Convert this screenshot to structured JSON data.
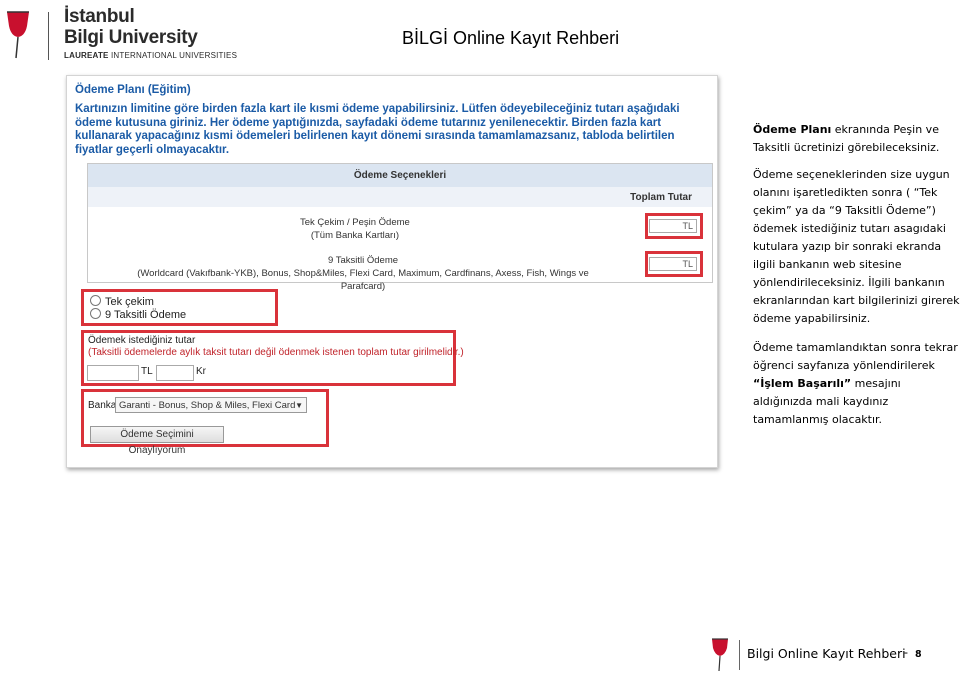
{
  "header": {
    "logo_line1": "İstanbul",
    "logo_line2": "Bilgi University",
    "logo_line3_bold": "LAUREATE",
    "logo_line3_rest": "INTERNATIONAL UNIVERSITIES",
    "doc_title": "BİLGİ Online Kayıt Rehberi"
  },
  "screenshot": {
    "plan_title": "Ödeme Planı (Eğitim)",
    "info_text": "Kartınızın limitine göre birden fazla kart ile kısmi ödeme yapabilirsiniz. Lütfen ödeyebileceğiniz tutarı aşağıdaki ödeme kutusuna giriniz. Her ödeme yaptığınızda, sayfadaki ödeme tutarınız yenilenecektir. Birden fazla kart kullanarak yapacağınız kısmi ödemeleri belirlenen kayıt dönemi sırasında tamamlamazsanız, tabloda belirtilen fiyatlar geçerli olmayacaktır.",
    "options_header": "Ödeme Seçenekleri",
    "total_header": "Toplam Tutar",
    "option1_line1": "Tek Çekim / Peşin Ödeme",
    "option1_line2": "(Tüm Banka Kartları)",
    "option2_line1": "9 Taksitli Ödeme",
    "option2_line2": "(Worldcard (Vakıfbank-YKB), Bonus, Shop&Miles, Flexi Card, Maximum, Cardfinans, Axess, Fish, Wings ve Parafcard)",
    "currency": "TL",
    "radio_options": [
      "Tek çekim",
      "9 Taksitli Ödeme"
    ],
    "amount_label": "Ödemek istediğiniz tutar",
    "amount_warning": "(Taksitli ödemelerde aylık taksit tutarı değil ödenmek istenen toplam tutar girilmelidir.)",
    "amount_tl": "TL",
    "amount_kr": "Kr",
    "bank_label": "Banka",
    "bank_selected": "Garanti - Bonus, Shop & Miles, Flexi Card",
    "confirm_button": "Ödeme Seçimini Onaylıyorum"
  },
  "side_text": {
    "p1_bold": "Ödeme Planı",
    "p1_rest": " ekranında Peşin ve Taksitli ücretinizi görebileceksiniz.",
    "p2": "Ödeme seçeneklerinden size uygun olanını işaretledikten sonra ( “Tek çekim” ya da “9 Taksitli Ödeme”) ödemek istediğiniz tutarı asagıdaki kutulara yazıp bir sonraki ekranda ilgili bankanın web sitesine yönlendirileceksiniz. İlgili bankanın ekranlarından kart bilgilerinizi girerek ödeme yapabilirsiniz.",
    "p3_a": "Ödeme tamamlandıktan sonra tekrar öğrenci sayfanıza yönlendirilerek ",
    "p3_bold": "“İşlem Başarılı”",
    "p3_b": " mesajını aldığınızda mali kaydınız tamamlanmış olacaktır."
  },
  "footer": {
    "title": "Bilgi Online Kayıt Rehberi",
    "dash": "-",
    "page": "8"
  },
  "colors": {
    "highlight_red": "#d9323a",
    "info_blue": "#1b5ba6",
    "logo_red": "#c8102e"
  }
}
